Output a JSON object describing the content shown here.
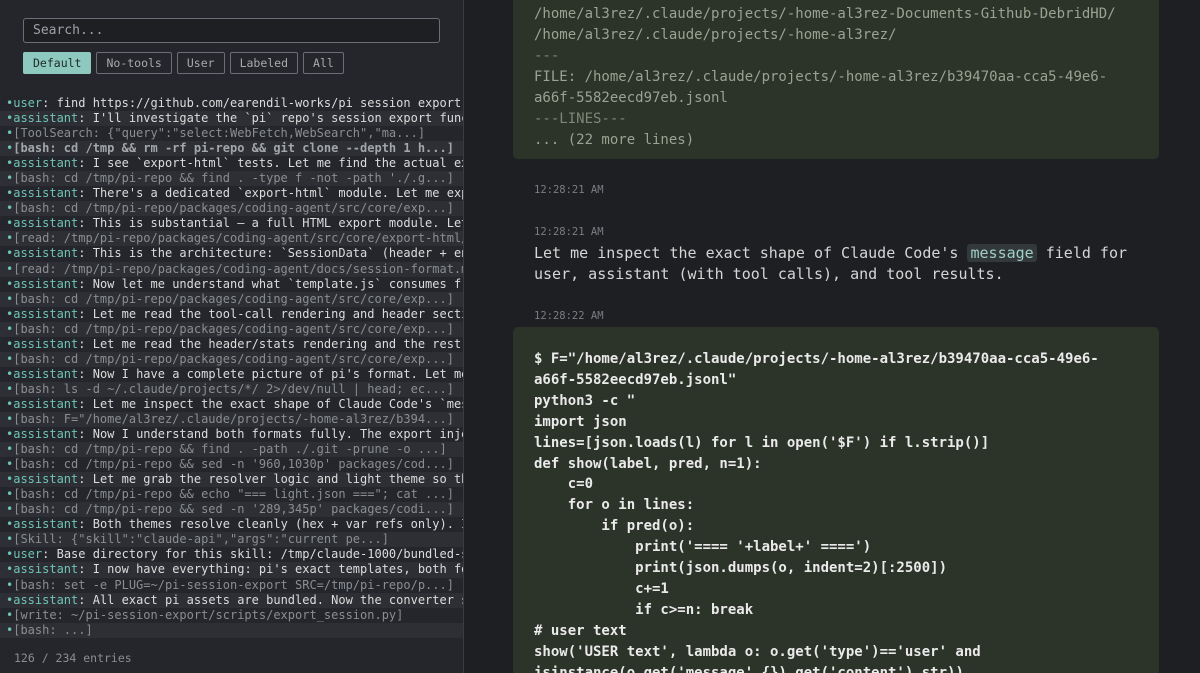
{
  "sidebar": {
    "search_placeholder": "Search...",
    "filters": [
      {
        "label": "Default",
        "active": true
      },
      {
        "label": "No-tools",
        "active": false
      },
      {
        "label": "User",
        "active": false
      },
      {
        "label": "Labeled",
        "active": false
      },
      {
        "label": "All",
        "active": false
      }
    ],
    "entries": [
      {
        "role": "user",
        "text": " find https://github.com/earendil-works/pi session export",
        "type": "msg"
      },
      {
        "role": "assistant",
        "text": " I'll investigate the `pi` repo's session export func",
        "type": "msg"
      },
      {
        "role": "",
        "text": "[ToolSearch: {\"query\":\"select:WebFetch,WebSearch\",\"ma...]",
        "type": "tool"
      },
      {
        "role": "",
        "text": "[bash: cd /tmp && rm -rf pi-repo && git clone --depth 1 h...]",
        "type": "bold"
      },
      {
        "role": "assistant",
        "text": " I see `export-html` tests. Let me find the actual ex",
        "type": "msg"
      },
      {
        "role": "",
        "text": "[bash: cd /tmp/pi-repo && find . -type f -not -path './.g...]",
        "type": "tool"
      },
      {
        "role": "assistant",
        "text": " There's a dedicated `export-html` module. Let me exp",
        "type": "msg"
      },
      {
        "role": "",
        "text": "[bash: cd /tmp/pi-repo/packages/coding-agent/src/core/exp...]",
        "type": "tool"
      },
      {
        "role": "assistant",
        "text": " This is substantial — a full HTML export module. Let",
        "type": "msg"
      },
      {
        "role": "",
        "text": "[read: /tmp/pi-repo/packages/coding-agent/src/core/export-html/",
        "type": "tool"
      },
      {
        "role": "assistant",
        "text": " This is the architecture: `SessionData` (header + en",
        "type": "msg"
      },
      {
        "role": "",
        "text": "[read: /tmp/pi-repo/packages/coding-agent/docs/session-format.m",
        "type": "tool"
      },
      {
        "role": "assistant",
        "text": " Now let me understand what `template.js` consumes fr",
        "type": "msg"
      },
      {
        "role": "",
        "text": "[bash: cd /tmp/pi-repo/packages/coding-agent/src/core/exp...]",
        "type": "tool"
      },
      {
        "role": "assistant",
        "text": " Let me read the tool-call rendering and header secti",
        "type": "msg"
      },
      {
        "role": "",
        "text": "[bash: cd /tmp/pi-repo/packages/coding-agent/src/core/exp...]",
        "type": "tool"
      },
      {
        "role": "assistant",
        "text": " Let me read the header/stats rendering and the rest",
        "type": "msg"
      },
      {
        "role": "",
        "text": "[bash: cd /tmp/pi-repo/packages/coding-agent/src/core/exp...]",
        "type": "tool"
      },
      {
        "role": "assistant",
        "text": " Now I have a complete picture of pi's format. Let me",
        "type": "msg"
      },
      {
        "role": "",
        "text": "[bash: ls -d ~/.claude/projects/*/ 2>/dev/null | head; ec...]",
        "type": "tool"
      },
      {
        "role": "assistant",
        "text": " Let me inspect the exact shape of Claude Code's `mes",
        "type": "msg"
      },
      {
        "role": "",
        "text": "[bash: F=\"/home/al3rez/.claude/projects/-home-al3rez/b394...]",
        "type": "tool"
      },
      {
        "role": "assistant",
        "text": " Now I understand both formats fully. The export inje",
        "type": "msg"
      },
      {
        "role": "",
        "text": "[bash: cd /tmp/pi-repo && find . -path ./.git -prune -o ...]",
        "type": "tool"
      },
      {
        "role": "",
        "text": "[bash: cd /tmp/pi-repo && sed -n '960,1030p' packages/cod...]",
        "type": "tool"
      },
      {
        "role": "assistant",
        "text": " Let me grab the resolver logic and light theme so th",
        "type": "msg"
      },
      {
        "role": "",
        "text": "[bash: cd /tmp/pi-repo && echo \"=== light.json ===\"; cat ...]",
        "type": "tool"
      },
      {
        "role": "",
        "text": "[bash: cd /tmp/pi-repo && sed -n '289,345p' packages/codi...]",
        "type": "tool"
      },
      {
        "role": "assistant",
        "text": " Both themes resolve cleanly (hex + var refs only). I",
        "type": "msg"
      },
      {
        "role": "",
        "text": "[Skill: {\"skill\":\"claude-api\",\"args\":\"current pe...]",
        "type": "tool"
      },
      {
        "role": "user",
        "text": " Base directory for this skill: /tmp/claude-1000/bundled-s",
        "type": "msg"
      },
      {
        "role": "assistant",
        "text": " I now have everything: pi's exact templates, both fo",
        "type": "msg"
      },
      {
        "role": "",
        "text": "[bash: set -e PLUG=~/pi-session-export SRC=/tmp/pi-repo/p...]",
        "type": "tool"
      },
      {
        "role": "assistant",
        "text": " All exact pi assets are bundled. Now the converter s",
        "type": "msg"
      },
      {
        "role": "",
        "text": "[write: ~/pi-session-export/scripts/export_session.py]",
        "type": "tool"
      },
      {
        "role": "",
        "text": "[bash: ...]",
        "type": "tool"
      }
    ],
    "entry_count": "126 / 234 entries"
  },
  "main": {
    "card1_lines": [
      "/home/al3rez/.claude/projects/-home-al3rez-Documents-Github-DebridHD/",
      "/home/al3rez/.claude/projects/-home-al3rez/",
      "---",
      "FILE: /home/al3rez/.claude/projects/-home-al3rez/b39470aa-cca5-49e6-",
      "a66f-5582eecd97eb.jsonl",
      "---LINES---",
      "... (22 more lines)"
    ],
    "timestamps": [
      "12:28:21 AM",
      "12:28:21 AM",
      "12:28:22 AM"
    ],
    "prose": {
      "before": "Let me inspect the exact shape of Claude Code's ",
      "code": "message",
      "after": " field for user, assistant (with tool calls), and tool results."
    },
    "code_block": "$ F=\"/home/al3rez/.claude/projects/-home-al3rez/b39470aa-cca5-49e6-\na66f-5582eecd97eb.jsonl\"\npython3 -c \"\nimport json\nlines=[json.loads(l) for l in open('$F') if l.strip()]\ndef show(label, pred, n=1):\n    c=0\n    for o in lines:\n        if pred(o):\n            print('==== '+label+' ====')\n            print(json.dumps(o, indent=2)[:2500])\n            c+=1\n            if c>=n: break\n# user text\nshow('USER text', lambda o: o.get('type')=='user' and\nisinstance(o.get('message',{}).get('content'),str))"
  }
}
